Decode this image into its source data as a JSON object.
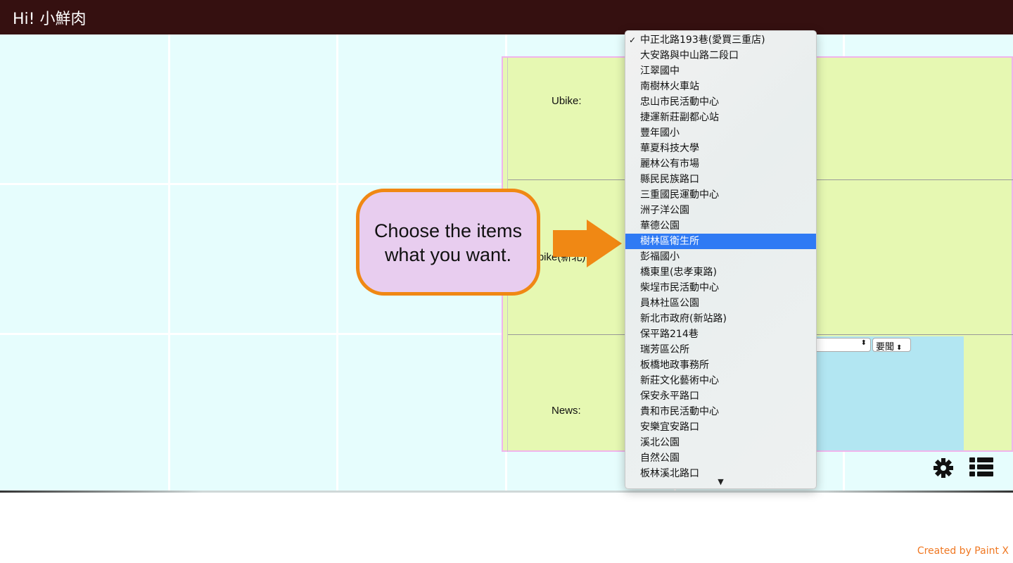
{
  "header": {
    "title": "Hi! 小鮮肉",
    "bg_color": "#351010"
  },
  "panel": {
    "rows": [
      {
        "label": "Ubike:"
      },
      {
        "label": "Ubike(新北)"
      },
      {
        "label": "News:"
      }
    ],
    "news_controls": {
      "select1_value": "",
      "select2_value": "要聞"
    }
  },
  "callout": {
    "line1": "Choose the items",
    "line2": "what you want."
  },
  "dropdown": {
    "selected_index": 13,
    "checked_index": 0,
    "options": [
      "中正北路193巷(愛買三重店)",
      "大安路與中山路二段口",
      "江翠國中",
      "南樹林火車站",
      "忠山市民活動中心",
      "捷運新莊副都心站",
      "豐年國小",
      "華夏科技大學",
      "麗林公有市場",
      "縣民民族路口",
      "三重國民運動中心",
      "洲子洋公園",
      "華德公園",
      "樹林區衛生所",
      "彭福國小",
      "橋東里(忠孝東路)",
      "柴埕市民活動中心",
      "員林社區公園",
      "新北市政府(新站路)",
      "保平路214巷",
      "瑞芳區公所",
      "板橋地政事務所",
      "新莊文化藝術中心",
      "保安永平路口",
      "貴和市民活動中心",
      "安樂宜安路口",
      "溪北公園",
      "自然公園",
      "板林溪北路口"
    ],
    "more_indicator": "▼"
  },
  "toolbar": {
    "settings_icon": "gear-icon",
    "list_icon": "list-icon"
  },
  "footer": {
    "credit": "Created by Paint X"
  },
  "colors": {
    "accent_orange": "#f08814",
    "selected_blue": "#2f7af4",
    "panel_bg": "#e6f8b2",
    "board_bg": "#e6fdfd"
  }
}
